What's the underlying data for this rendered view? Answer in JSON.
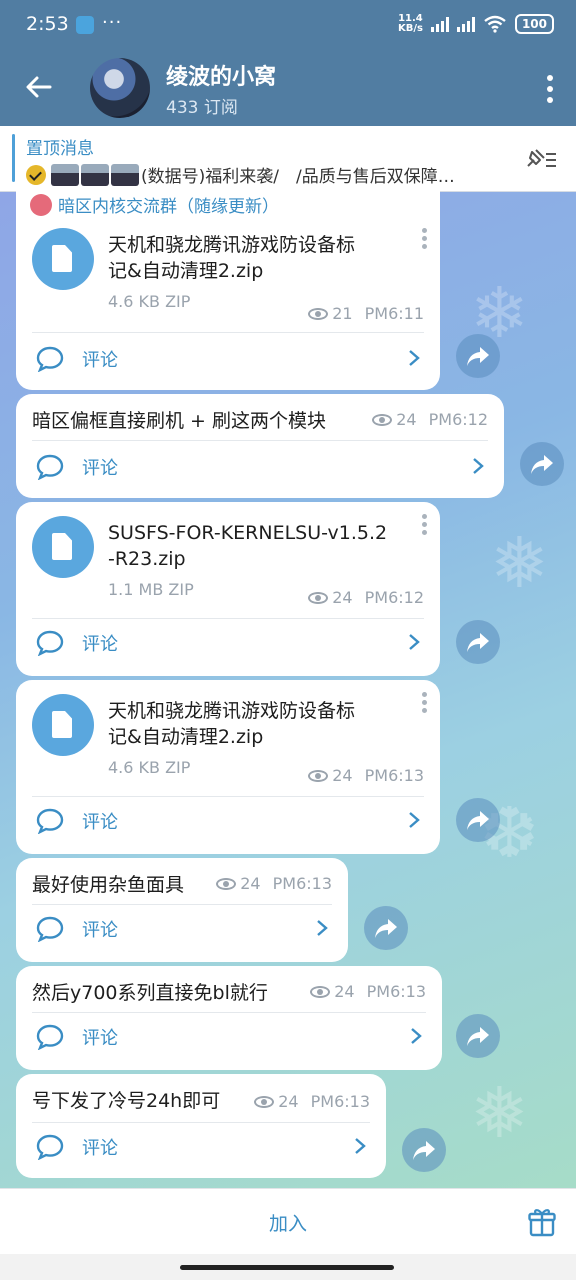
{
  "status_bar": {
    "time": "2:53",
    "network_speed": "11.4",
    "network_unit": "KB/s",
    "battery": "100"
  },
  "header": {
    "title": "绫波的小窝",
    "subtitle": "433 订阅"
  },
  "pinned": {
    "label": "置顶消息",
    "text": "(数据号)福利来袭/　/品质与售后双保障…"
  },
  "group_header": "暗区内核交流群（随缘更新）",
  "messages": [
    {
      "type": "file",
      "file_name_line1": "天机和骁龙腾讯游戏防设备标",
      "file_name_line2": "记&自动清理2.zip",
      "size": "4.6 KB ZIP",
      "views": "21",
      "time": "PM6:11",
      "comment": "评论"
    },
    {
      "type": "text",
      "text": "暗区偏框直接刷机 + 刷这两个模块",
      "views": "24",
      "time": "PM6:12",
      "comment": "评论"
    },
    {
      "type": "file",
      "file_name_line1": "SUSFS-FOR-KERNELSU-v1.5.2",
      "file_name_line2": "-R23.zip",
      "size": "1.1 MB ZIP",
      "views": "24",
      "time": "PM6:12",
      "comment": "评论"
    },
    {
      "type": "file",
      "file_name_line1": "天机和骁龙腾讯游戏防设备标",
      "file_name_line2": "记&自动清理2.zip",
      "size": "4.6 KB ZIP",
      "views": "24",
      "time": "PM6:13",
      "comment": "评论"
    },
    {
      "type": "text",
      "text": "最好使用杂鱼面具",
      "views": "24",
      "time": "PM6:13",
      "comment": "评论"
    },
    {
      "type": "text",
      "text": "然后y700系列直接免bl就行",
      "views": "24",
      "time": "PM6:13",
      "comment": "评论"
    },
    {
      "type": "text",
      "text": "号下发了冷号24h即可",
      "views": "24",
      "time": "PM6:13",
      "comment": "评论"
    }
  ],
  "bottom": {
    "join_label": "加入"
  },
  "colors": {
    "header": "#517da2",
    "accent": "#3a8dc4",
    "file_icon": "#5aa7de"
  }
}
